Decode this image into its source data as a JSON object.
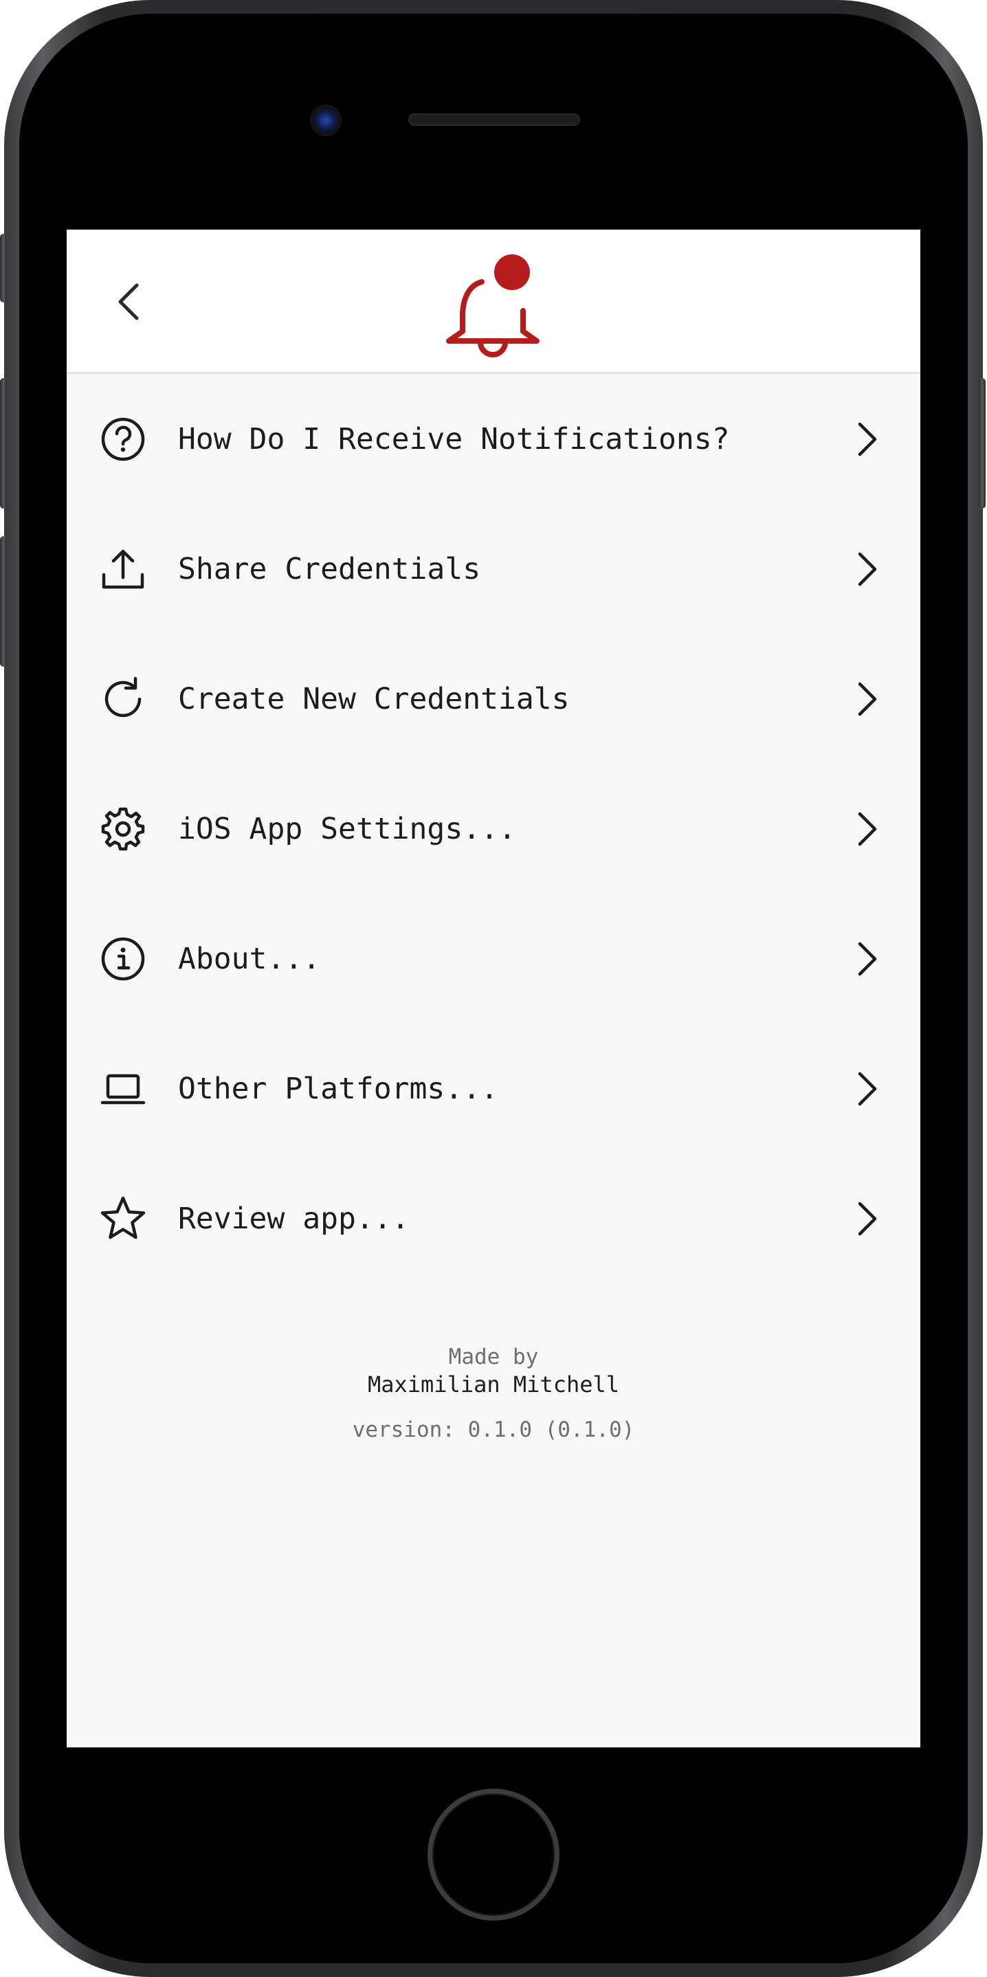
{
  "colors": {
    "accent": "#b71c1c",
    "text": "#1c1c1c",
    "muted": "#6e6e6e",
    "background": "#f8f8f8"
  },
  "nav": {
    "back_icon": "chevron-left-icon",
    "logo_icon": "bell-notification-icon"
  },
  "menu": {
    "items": [
      {
        "label": "How Do I Receive Notifications?",
        "icon": "question-circle-icon"
      },
      {
        "label": "Share Credentials",
        "icon": "share-upload-icon"
      },
      {
        "label": "Create New Credentials",
        "icon": "refresh-icon"
      },
      {
        "label": "iOS App Settings...",
        "icon": "gear-icon"
      },
      {
        "label": "About...",
        "icon": "info-circle-icon"
      },
      {
        "label": "Other Platforms...",
        "icon": "laptop-icon"
      },
      {
        "label": "Review app...",
        "icon": "star-icon"
      }
    ]
  },
  "footer": {
    "made_by": "Made by",
    "author": "Maximilian Mitchell",
    "version": "version: 0.1.0 (0.1.0)"
  }
}
